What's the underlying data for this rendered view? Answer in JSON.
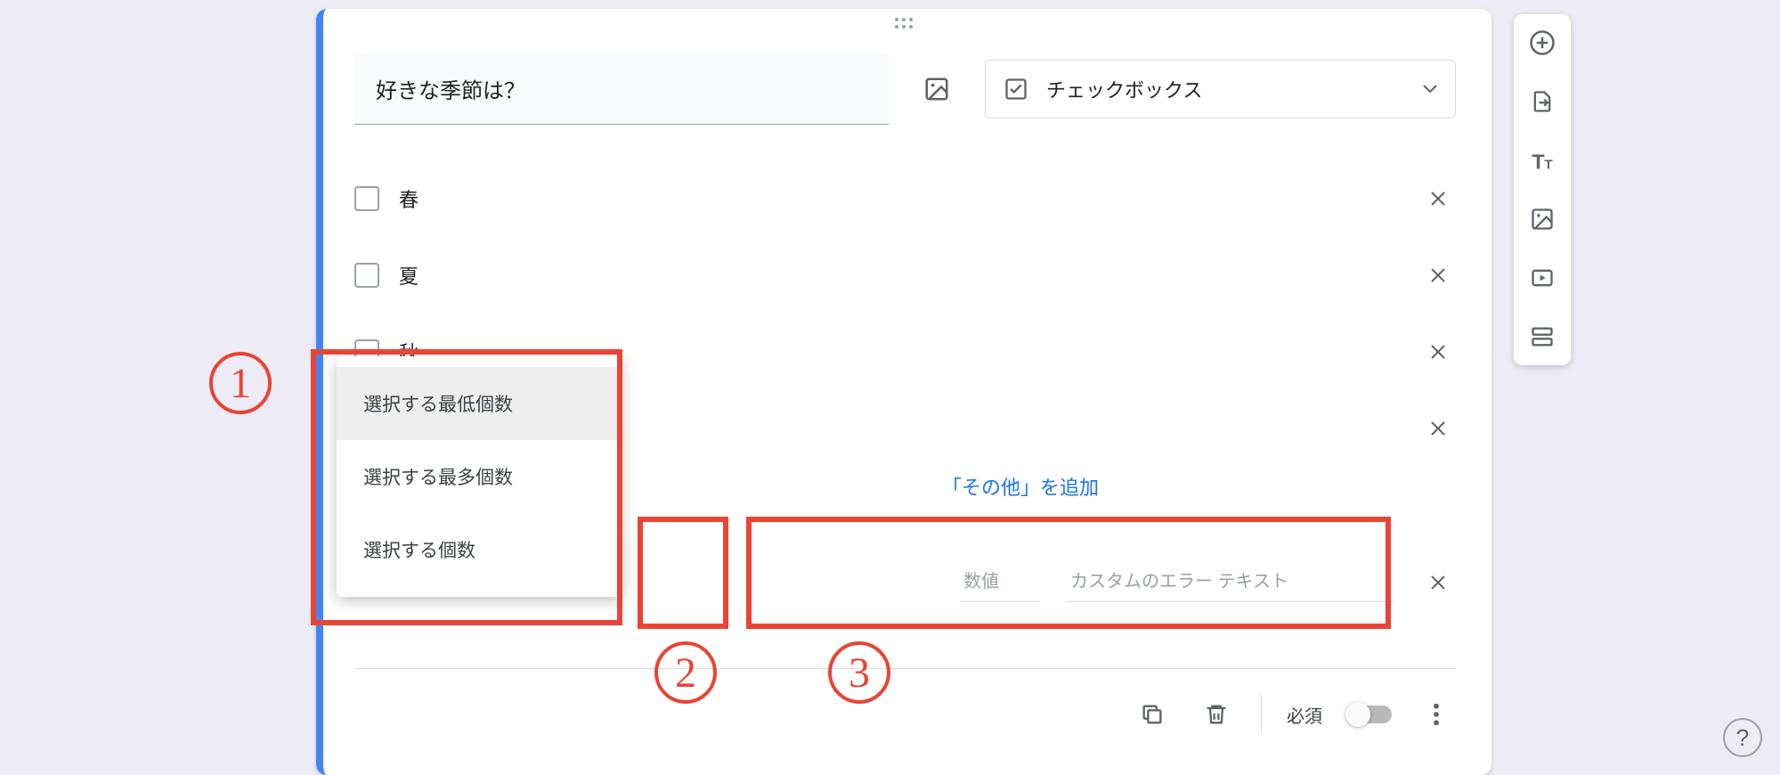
{
  "question": {
    "title": "好きな季節は？"
  },
  "type_select": {
    "label": "チェックボックス"
  },
  "options": [
    {
      "label": "春"
    },
    {
      "label": "夏"
    },
    {
      "label": "秋"
    },
    {
      "label": ""
    }
  ],
  "add_other_label": "「その他」を追加",
  "validation_menu": {
    "items": [
      "選択する最低個数",
      "選択する最多個数",
      "選択する個数"
    ]
  },
  "validation_inputs": {
    "number_placeholder": "数値",
    "error_placeholder": "カスタムのエラー テキスト"
  },
  "footer": {
    "required_label": "必須"
  },
  "annotations": {
    "n1": "1",
    "n2": "2",
    "n3": "3"
  },
  "help": "?"
}
